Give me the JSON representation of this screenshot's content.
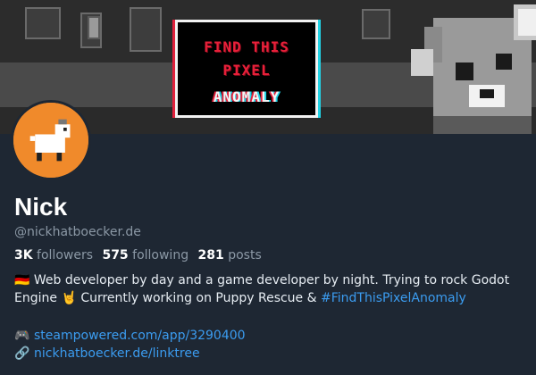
{
  "banner": {
    "title_line1": "FIND THIS",
    "title_line2": "PIXEL",
    "title_line3": "ANOMALY"
  },
  "profile": {
    "name": "Nick",
    "handle": "@nickhatboecker.de"
  },
  "stats": {
    "followers_count": "3K",
    "followers_label": "followers",
    "following_count": "575",
    "following_label": "following",
    "posts_count": "281",
    "posts_label": "posts"
  },
  "bio": {
    "flag": "🇩🇪",
    "text1": "Web developer by day and a game developer by night. Trying to rock Godot Engine",
    "rock_emoji": "🤘",
    "text2": "Currently working on Puppy Rescue &",
    "hashtag": "#FindThisPixelAnomaly"
  },
  "links": [
    {
      "icon": "🎮",
      "label": "steampowered.com/app/3290400"
    },
    {
      "icon": "🔗",
      "label": "nickhatboecker.de/linktree"
    }
  ],
  "colors": {
    "background": "#1e2733",
    "link": "#3b9cf0",
    "avatar_bg": "#f08a2b",
    "muted": "#8b98a5"
  }
}
